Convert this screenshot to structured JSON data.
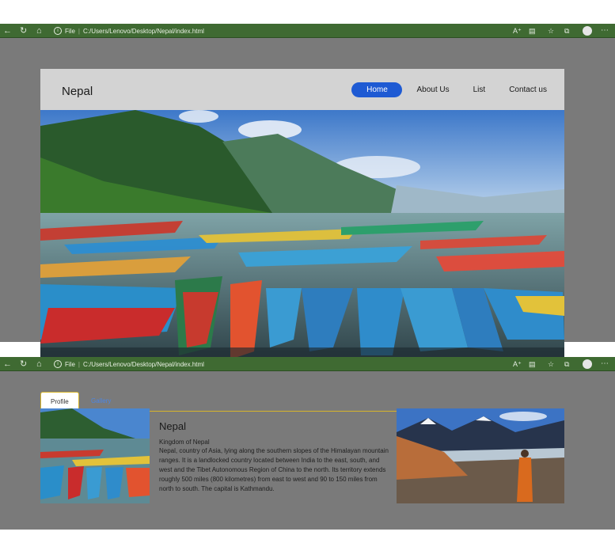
{
  "browser": {
    "info_label": "File",
    "address": "C:/Users/Lenovo/Desktop/Nepal/index.html",
    "icons": [
      "back-icon",
      "reload-icon",
      "home-icon",
      "read-aloud-icon",
      "extensions-icon",
      "favorites-icon",
      "collections-icon",
      "profile-icon",
      "more-icon"
    ]
  },
  "site": {
    "brand": "Nepal",
    "nav": [
      "Home",
      "About Us",
      "List",
      "Contact us"
    ],
    "active_nav": "Home"
  },
  "tabs": {
    "profile": "Profile",
    "gallery": "Gallery"
  },
  "article": {
    "title": "Nepal",
    "subtitle": "Kingdom of Nepal",
    "body": "Nepal, country of Asia, lying along the southern slopes of the Himalayan mountain ranges. It is a landlocked country located between India to the east, south, and west and the Tibet Autonomous Region of China to the north. Its territory extends roughly 500 miles (800 kilometres) from east to west and 90 to 150 miles from north to south. The capital is Kathmandu."
  },
  "colors": {
    "chrome": "#3f6a32",
    "accent": "#1e5ad3",
    "tab_border": "#d6b52b",
    "page_bg": "#7a7a7a"
  }
}
